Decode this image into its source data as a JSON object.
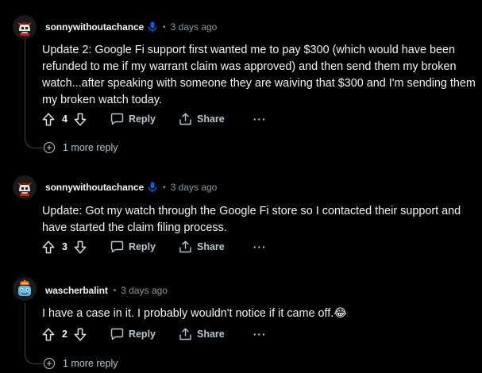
{
  "comments": [
    {
      "username": "sonnywithoutachance",
      "separator": "•",
      "time": "3 days ago",
      "body": "Update 2: Google Fi support first wanted me to pay $300 (which would have been refunded to me if my warrant claim was approved) and then send them my broken watch...after speaking with someone they are waiving that $300 and I'm sending them my broken watch today.",
      "votes": "4",
      "reply_label": "Reply",
      "share_label": "Share",
      "more_label": "···",
      "more_replies": "1 more reply"
    },
    {
      "username": "sonnywithoutachance",
      "separator": "•",
      "time": "3 days ago",
      "body": "Update: Got my watch through the Google Fi store so I contacted their support and have started the claim filing process.",
      "votes": "3",
      "reply_label": "Reply",
      "share_label": "Share",
      "more_label": "···"
    },
    {
      "username": "wascherbalint",
      "separator": "•",
      "time": "3 days ago",
      "body": "I have a case in it. I probably wouldn't notice if it came off.😂",
      "votes": "2",
      "reply_label": "Reply",
      "share_label": "Share",
      "more_label": "···",
      "more_replies": "1 more reply"
    }
  ],
  "icons": {
    "mic": "microphone-icon",
    "upvote": "upvote-arrow-icon",
    "downvote": "downvote-arrow-icon",
    "reply": "comment-bubble-icon",
    "share": "share-icon",
    "expand": "plus-circle-icon"
  },
  "colors": {
    "background": "#000000",
    "text": "#f2f4f5",
    "muted": "#8b9aa2",
    "mic_blue": "#0a5fdc"
  }
}
